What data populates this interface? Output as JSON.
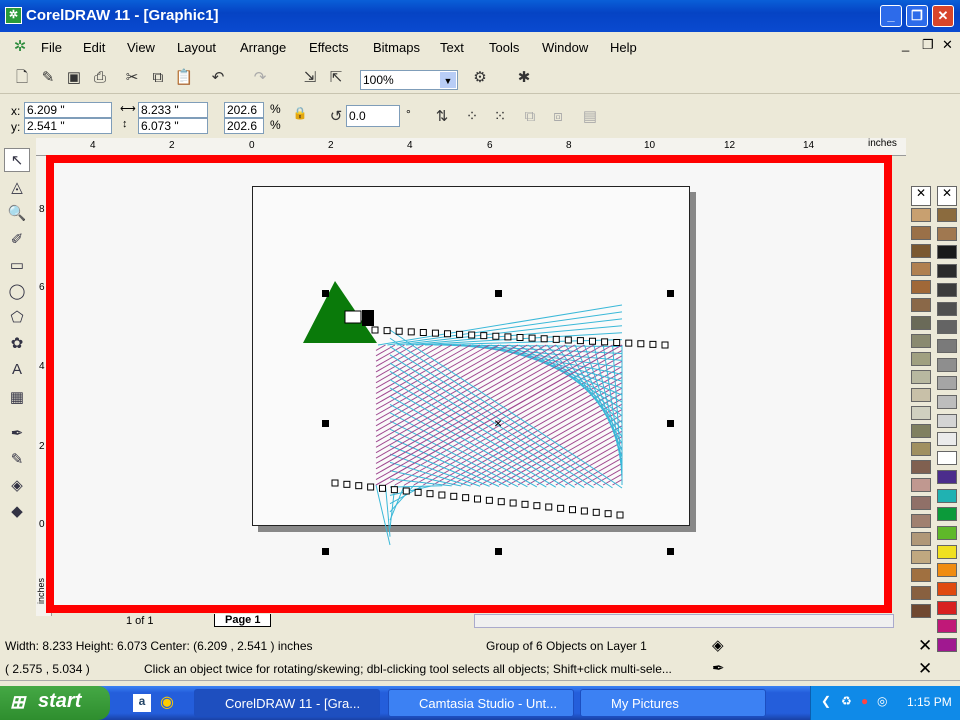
{
  "window": {
    "title": "CorelDRAW 11 - [Graphic1]",
    "min": "_",
    "max": "❐",
    "close": "✕"
  },
  "menu": [
    "File",
    "Edit",
    "View",
    "Layout",
    "Arrange",
    "Effects",
    "Bitmaps",
    "Text",
    "Tools",
    "Window",
    "Help"
  ],
  "toolbar": {
    "zoom_value": "100%"
  },
  "property_bar": {
    "x_label": "x:",
    "x": "6.209 \"",
    "y_label": "y:",
    "y": "2.541 \"",
    "width": "8.233 \"",
    "height": "6.073 \"",
    "scale_x": "202.6",
    "scale_y": "202.6",
    "pct": "%",
    "rotation": "0.0",
    "deg": "°"
  },
  "ruler": {
    "h_labels": [
      "4",
      "2",
      "0",
      "2",
      "4",
      "6",
      "8",
      "10",
      "12",
      "14"
    ],
    "units": "inches",
    "v_labels": [
      "8",
      "6",
      "4",
      "2",
      "0"
    ],
    "v_units": "inches"
  },
  "page_nav": {
    "of": "1 of 1",
    "page_tab": "Page 1"
  },
  "status": {
    "size": "Width: 8.233  Height: 6.073  Center: (6.209 , 2.541 ) inches",
    "object": "Group of 6 Objects on Layer 1",
    "coords": "( 2.575 , 5.034 )",
    "hint": "Click an object twice for rotating/skewing; dbl-clicking tool selects all objects; Shift+click multi-sele..."
  },
  "palette": [
    "#8b6b3e",
    "#a07850",
    "#1a1a1a",
    "#2b2b2b",
    "#3d3d3d",
    "#505050",
    "#646464",
    "#7a7a7a",
    "#8e8e8e",
    "#a5a5a5",
    "#bdbdbd",
    "#d4d4d4",
    "#ebebeb",
    "#ffffff",
    "#4b2d8c",
    "#20b2b2",
    "#0c9a3a",
    "#5fb82a",
    "#f0e020",
    "#f08c10",
    "#e04a10",
    "#d82020",
    "#c01878",
    "#a01890"
  ],
  "palette_left": [
    "#c8a070",
    "#9a7048",
    "#7a5830",
    "#b08050",
    "#a06838",
    "#8a6848",
    "#6a6a58",
    "#8a8a70",
    "#a0a080",
    "#b8b8a0",
    "#c8c0a8",
    "#d0d0c0",
    "#808060",
    "#a09060",
    "#806050",
    "#c09890",
    "#907068",
    "#a08070",
    "#b09878",
    "#c0a880",
    "#a07040",
    "#886040",
    "#704830"
  ],
  "taskbar": {
    "start": "start",
    "tasks": [
      "CorelDRAW 11 - [Gra...",
      "Camtasia Studio - Unt...",
      "My Pictures"
    ],
    "clock": "1:15 PM"
  },
  "colors": {
    "frame": "#ff0000",
    "triangle": "#0a7a0a",
    "cyan": "#3ab8d8",
    "purple": "#a04890"
  }
}
